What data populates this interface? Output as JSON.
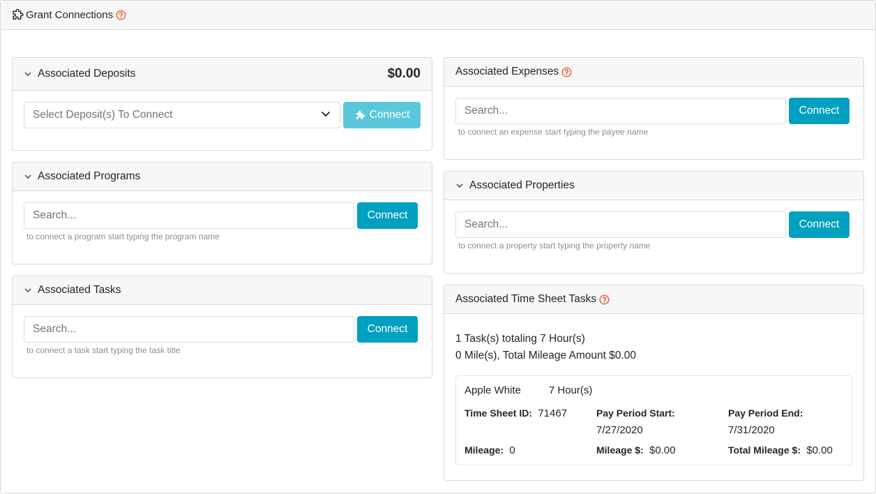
{
  "header": {
    "title": "Grant Connections"
  },
  "deposits": {
    "title": "Associated Deposits",
    "amount": "$0.00",
    "select_value": "Select Deposit(s) To Connect",
    "connect_label": "Connect"
  },
  "programs": {
    "title": "Associated Programs",
    "placeholder": "Search...",
    "connect_label": "Connect",
    "hint": "to connect a program start typing the program name"
  },
  "tasks": {
    "title": "Associated Tasks",
    "placeholder": "Search...",
    "connect_label": "Connect",
    "hint": "to connect a task start typing the task title"
  },
  "expenses": {
    "title": "Associated Expenses",
    "placeholder": "Search...",
    "connect_label": "Connect",
    "hint": "to connect an expense start typing the payee name"
  },
  "properties": {
    "title": "Associated Properties",
    "placeholder": "Search...",
    "connect_label": "Connect",
    "hint": "to connect a property start typing the property name"
  },
  "timesheet": {
    "title": "Associated Time Sheet Tasks",
    "summary_tasks": "1 Task(s) totaling 7 Hour(s)",
    "summary_mileage": "0 Mile(s), Total Mileage Amount $0.00",
    "entry": {
      "name": "Apple White",
      "hours": "7 Hour(s)",
      "id_label": "Time Sheet ID:",
      "id_value": "71467",
      "start_label": "Pay Period Start:",
      "start_value": "7/27/2020",
      "end_label": "Pay Period End:",
      "end_value": "7/31/2020",
      "mileage_label": "Mileage:",
      "mileage_value": "0",
      "mileage_amt_label": "Mileage $:",
      "mileage_amt_value": "$0.00",
      "total_mileage_label": "Total Mileage $:",
      "total_mileage_value": "$0.00"
    }
  },
  "colors": {
    "accent": "#00a0c0",
    "accent_disabled": "#5bc7dc",
    "help": "#e8531c"
  },
  "icons": [
    "puzzle-icon",
    "help-icon",
    "chevron-down-icon"
  ]
}
